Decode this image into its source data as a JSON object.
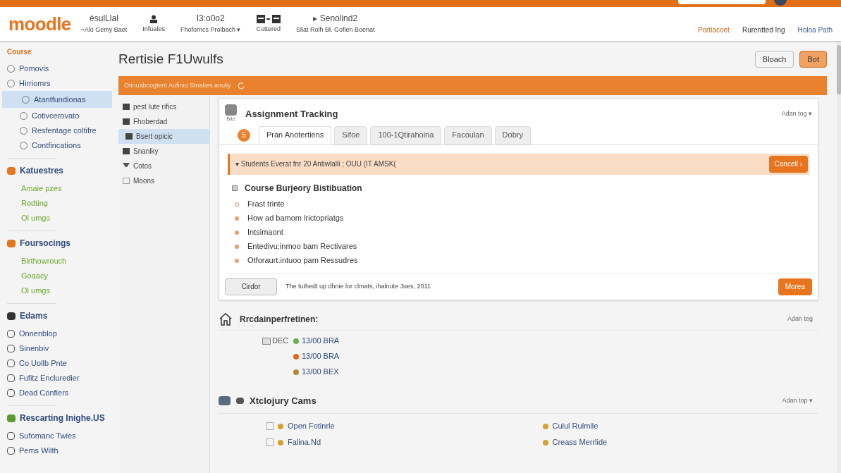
{
  "topbar": {
    "search": true,
    "avatar": true
  },
  "header": {
    "logo": "moodle",
    "items": [
      {
        "kind": "text",
        "top": "ésulLlal",
        "bottom": "~Alo Gemy Baet"
      },
      {
        "kind": "icon",
        "bottom": "Infuales"
      },
      {
        "kind": "text",
        "top": "I3:o0o2",
        "bottom": "Fhoforncs Prolbach ▾"
      },
      {
        "kind": "icon2",
        "bottom": "Cottered"
      },
      {
        "kind": "text",
        "top": "▸ Senolind2",
        "bottom": "Sliat Rolh Bł. Gofien Boenat"
      }
    ],
    "links": [
      {
        "label": "Portiacoet",
        "color": "#c8651b"
      },
      {
        "label": "Rurentted Ing",
        "color": "#333333"
      },
      {
        "label": "Holoa Path",
        "color": "#3a5a9a"
      }
    ]
  },
  "sidebar": {
    "sections": [
      {
        "heading": "Course",
        "items": [
          {
            "label": "Pomovis",
            "selected": false
          },
          {
            "label": "Hirriomrs",
            "selected": false
          },
          {
            "label": "Atantfundionas",
            "selected": true
          },
          {
            "label": "Cotivcerovato",
            "selected": false
          },
          {
            "label": "Resfentage coltifre",
            "selected": false
          },
          {
            "label": "Contfincations",
            "selected": false
          }
        ]
      },
      {
        "heading": "Katuestres",
        "items": [
          {
            "label": "Amaie pzes",
            "selected": false
          },
          {
            "label": "Rodting",
            "selected": false
          },
          {
            "label": "Ol umgs",
            "selected": false
          }
        ]
      },
      {
        "heading": "Foursocings",
        "items": [
          {
            "label": "Birthowrouch",
            "selected": false
          },
          {
            "label": "Goaacy",
            "selected": false
          },
          {
            "label": "Ol umgs",
            "selected": false
          }
        ]
      },
      {
        "heading": "Edams",
        "items": [
          {
            "label": "Onnenblop",
            "selected": false
          },
          {
            "label": "Sinenbiv",
            "selected": false
          },
          {
            "label": "Co Uollb Pnte",
            "selected": false
          },
          {
            "label": "Fufitz Encluredier",
            "selected": false
          },
          {
            "label": "Dead Confiers",
            "selected": false
          }
        ]
      },
      {
        "heading": "Rescarting Inighe.US",
        "items": [
          {
            "label": "Sufomanc Twies",
            "selected": false
          },
          {
            "label": "Pems Wilth",
            "selected": false
          }
        ]
      }
    ]
  },
  "page": {
    "title": "Rertisie F1Uwulfs",
    "buttons": [
      {
        "label": "Bloach",
        "primary": false
      },
      {
        "label": "Bot",
        "primary": true
      }
    ],
    "banner": "Otinuabcogtent Aufinio Stnafies.anuliy"
  },
  "subnav": [
    {
      "label": "pest lute rifics",
      "selected": false
    },
    {
      "label": "Fhoberdad",
      "selected": false
    },
    {
      "label": "Bsert opicic",
      "selected": true
    },
    {
      "label": "Snanlky",
      "selected": false
    },
    {
      "label": "Cotos",
      "selected": false
    },
    {
      "label": "Moons",
      "selected": false
    }
  ],
  "card": {
    "icon_caption": "Bite",
    "title": "Assignment Tracking",
    "action": "Adan tog ▾",
    "badge": "5",
    "tabs": [
      {
        "label": "Pran Anotertiens",
        "selected": true
      },
      {
        "label": "Sifoe",
        "selected": false
      },
      {
        "label": "100-1Qtirahoina",
        "selected": false
      },
      {
        "label": "Facoulan",
        "selected": false
      },
      {
        "label": "Dobry",
        "selected": false
      }
    ],
    "alert": {
      "text": "▾ Students Everat fnr 20 Antiwlalli ; OUU (IT AMSK(",
      "button": "Cancell ›"
    },
    "list_title": "Course Burjeory Bistibuation",
    "list": [
      "Frast trinte",
      "How ad bamom lrictopriatgs",
      "Intsimaont",
      "Entedivu:inmoo bam Rectivares",
      "Otforaurt.intuoo pam Ressudres"
    ],
    "footer": {
      "button": "Cirdor",
      "text": "The tuthedt up dhnie lor clmats, ihalnute Jues, 2011",
      "primary": "Morea"
    }
  },
  "section2": {
    "title": "Rrcdainperfretinen:",
    "action": "Adan teg",
    "label": "DEC",
    "rows": [
      {
        "text": "13/00 BRA",
        "color": "#6ab04c"
      },
      {
        "text": "13/00 BRA",
        "color": "#e06a1b"
      },
      {
        "text": "13/00 BEX",
        "color": "#b08a3a"
      }
    ]
  },
  "section3": {
    "title": "Xtclojury Cams",
    "action": "Adan top ▾",
    "items": [
      {
        "label": "Open Fotinrle"
      },
      {
        "label": "Culul Rulmile"
      },
      {
        "label": "Falina.Nd"
      },
      {
        "label": "Creass Merrlide"
      }
    ]
  }
}
